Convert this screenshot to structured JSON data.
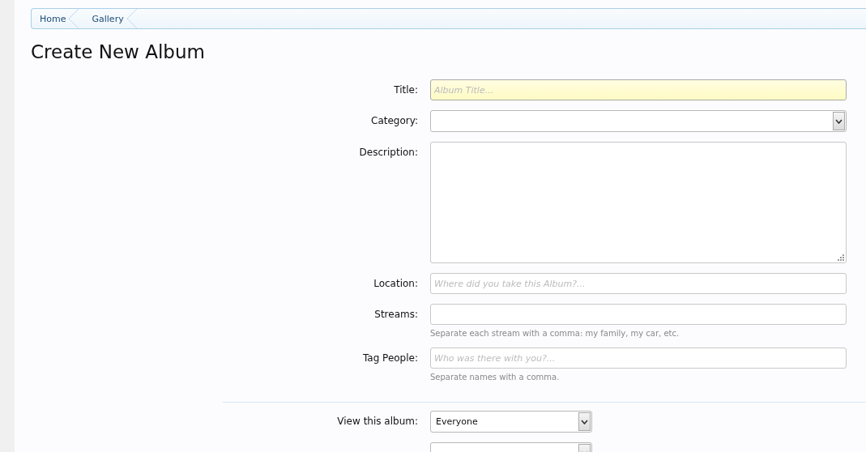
{
  "breadcrumb": [
    {
      "label": "Home"
    },
    {
      "label": "Gallery"
    }
  ],
  "heading": "Create New Album",
  "fields": [
    {
      "kind": "text",
      "label": "Title:",
      "placeholder": "Album Title...",
      "focused": true
    },
    {
      "kind": "select",
      "label": "Category:",
      "focused": false
    },
    {
      "kind": "textarea",
      "label": "Description:",
      "focused": false
    },
    {
      "kind": "text",
      "label": "Location:",
      "placeholder": "Where did you take this Album?...",
      "focused": false
    },
    {
      "kind": "text",
      "label": "Streams:",
      "hint": "Separate each stream with a comma: my family, my car, etc.",
      "focused": false
    },
    {
      "kind": "text",
      "label": "Tag People:",
      "placeholder": "Who was there with you?...",
      "hint": "Separate names with a comma.",
      "focused": false
    }
  ],
  "privacy_fields": [
    {
      "kind": "select",
      "label": "View this album:",
      "value": "Everyone"
    },
    {
      "kind": "select"
    }
  ]
}
